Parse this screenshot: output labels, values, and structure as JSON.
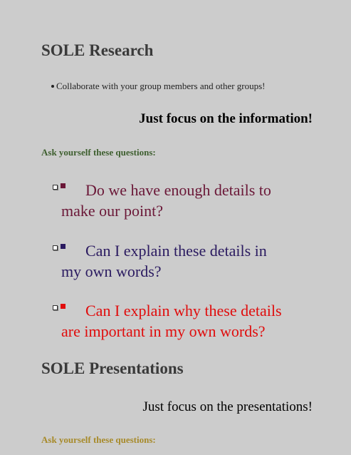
{
  "colors": {
    "background": "#cccccc",
    "heading": "#3a3a3a",
    "ask_1": "#3e5f2f",
    "ask_2": "#a78a2a",
    "q1": "#6a1737",
    "q2": "#2a1a60",
    "q3": "#e00c0c"
  },
  "research": {
    "heading": "SOLE Research",
    "bullet": "Collaborate with your group members and other groups!",
    "focus": "Just focus on the information!",
    "ask": "Ask yourself these questions:",
    "questions": [
      {
        "line1": "Do we have enough details to",
        "line2": "make our point?"
      },
      {
        "line1": "Can I explain these details in",
        "line2": "my own words?"
      },
      {
        "line1": "Can I explain why these details",
        "line2": "are important in my own words?"
      }
    ]
  },
  "presentations": {
    "heading": "SOLE Presentations",
    "focus": "Just focus on the presentations!",
    "ask": "Ask yourself these questions:"
  }
}
